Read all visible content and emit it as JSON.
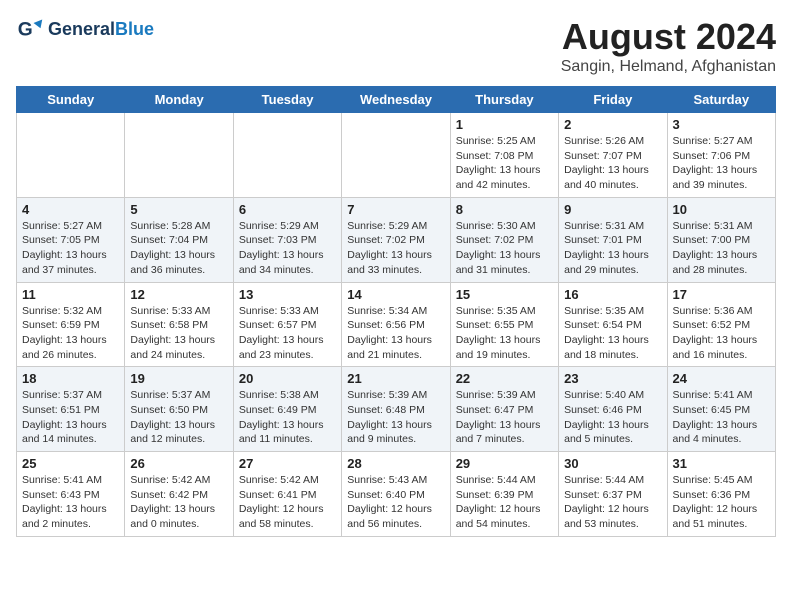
{
  "header": {
    "logo_line1": "General",
    "logo_line2": "Blue",
    "month": "August 2024",
    "location": "Sangin, Helmand, Afghanistan"
  },
  "days_of_week": [
    "Sunday",
    "Monday",
    "Tuesday",
    "Wednesday",
    "Thursday",
    "Friday",
    "Saturday"
  ],
  "weeks": [
    [
      {
        "day": "",
        "info": ""
      },
      {
        "day": "",
        "info": ""
      },
      {
        "day": "",
        "info": ""
      },
      {
        "day": "",
        "info": ""
      },
      {
        "day": "1",
        "info": "Sunrise: 5:25 AM\nSunset: 7:08 PM\nDaylight: 13 hours\nand 42 minutes."
      },
      {
        "day": "2",
        "info": "Sunrise: 5:26 AM\nSunset: 7:07 PM\nDaylight: 13 hours\nand 40 minutes."
      },
      {
        "day": "3",
        "info": "Sunrise: 5:27 AM\nSunset: 7:06 PM\nDaylight: 13 hours\nand 39 minutes."
      }
    ],
    [
      {
        "day": "4",
        "info": "Sunrise: 5:27 AM\nSunset: 7:05 PM\nDaylight: 13 hours\nand 37 minutes."
      },
      {
        "day": "5",
        "info": "Sunrise: 5:28 AM\nSunset: 7:04 PM\nDaylight: 13 hours\nand 36 minutes."
      },
      {
        "day": "6",
        "info": "Sunrise: 5:29 AM\nSunset: 7:03 PM\nDaylight: 13 hours\nand 34 minutes."
      },
      {
        "day": "7",
        "info": "Sunrise: 5:29 AM\nSunset: 7:02 PM\nDaylight: 13 hours\nand 33 minutes."
      },
      {
        "day": "8",
        "info": "Sunrise: 5:30 AM\nSunset: 7:02 PM\nDaylight: 13 hours\nand 31 minutes."
      },
      {
        "day": "9",
        "info": "Sunrise: 5:31 AM\nSunset: 7:01 PM\nDaylight: 13 hours\nand 29 minutes."
      },
      {
        "day": "10",
        "info": "Sunrise: 5:31 AM\nSunset: 7:00 PM\nDaylight: 13 hours\nand 28 minutes."
      }
    ],
    [
      {
        "day": "11",
        "info": "Sunrise: 5:32 AM\nSunset: 6:59 PM\nDaylight: 13 hours\nand 26 minutes."
      },
      {
        "day": "12",
        "info": "Sunrise: 5:33 AM\nSunset: 6:58 PM\nDaylight: 13 hours\nand 24 minutes."
      },
      {
        "day": "13",
        "info": "Sunrise: 5:33 AM\nSunset: 6:57 PM\nDaylight: 13 hours\nand 23 minutes."
      },
      {
        "day": "14",
        "info": "Sunrise: 5:34 AM\nSunset: 6:56 PM\nDaylight: 13 hours\nand 21 minutes."
      },
      {
        "day": "15",
        "info": "Sunrise: 5:35 AM\nSunset: 6:55 PM\nDaylight: 13 hours\nand 19 minutes."
      },
      {
        "day": "16",
        "info": "Sunrise: 5:35 AM\nSunset: 6:54 PM\nDaylight: 13 hours\nand 18 minutes."
      },
      {
        "day": "17",
        "info": "Sunrise: 5:36 AM\nSunset: 6:52 PM\nDaylight: 13 hours\nand 16 minutes."
      }
    ],
    [
      {
        "day": "18",
        "info": "Sunrise: 5:37 AM\nSunset: 6:51 PM\nDaylight: 13 hours\nand 14 minutes."
      },
      {
        "day": "19",
        "info": "Sunrise: 5:37 AM\nSunset: 6:50 PM\nDaylight: 13 hours\nand 12 minutes."
      },
      {
        "day": "20",
        "info": "Sunrise: 5:38 AM\nSunset: 6:49 PM\nDaylight: 13 hours\nand 11 minutes."
      },
      {
        "day": "21",
        "info": "Sunrise: 5:39 AM\nSunset: 6:48 PM\nDaylight: 13 hours\nand 9 minutes."
      },
      {
        "day": "22",
        "info": "Sunrise: 5:39 AM\nSunset: 6:47 PM\nDaylight: 13 hours\nand 7 minutes."
      },
      {
        "day": "23",
        "info": "Sunrise: 5:40 AM\nSunset: 6:46 PM\nDaylight: 13 hours\nand 5 minutes."
      },
      {
        "day": "24",
        "info": "Sunrise: 5:41 AM\nSunset: 6:45 PM\nDaylight: 13 hours\nand 4 minutes."
      }
    ],
    [
      {
        "day": "25",
        "info": "Sunrise: 5:41 AM\nSunset: 6:43 PM\nDaylight: 13 hours\nand 2 minutes."
      },
      {
        "day": "26",
        "info": "Sunrise: 5:42 AM\nSunset: 6:42 PM\nDaylight: 13 hours\nand 0 minutes."
      },
      {
        "day": "27",
        "info": "Sunrise: 5:42 AM\nSunset: 6:41 PM\nDaylight: 12 hours\nand 58 minutes."
      },
      {
        "day": "28",
        "info": "Sunrise: 5:43 AM\nSunset: 6:40 PM\nDaylight: 12 hours\nand 56 minutes."
      },
      {
        "day": "29",
        "info": "Sunrise: 5:44 AM\nSunset: 6:39 PM\nDaylight: 12 hours\nand 54 minutes."
      },
      {
        "day": "30",
        "info": "Sunrise: 5:44 AM\nSunset: 6:37 PM\nDaylight: 12 hours\nand 53 minutes."
      },
      {
        "day": "31",
        "info": "Sunrise: 5:45 AM\nSunset: 6:36 PM\nDaylight: 12 hours\nand 51 minutes."
      }
    ]
  ]
}
